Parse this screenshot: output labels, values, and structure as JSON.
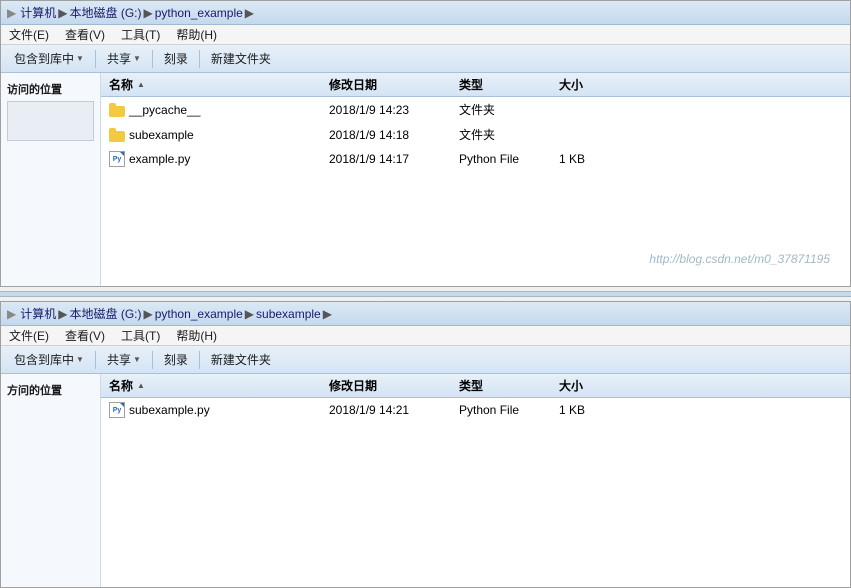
{
  "window1": {
    "address": {
      "parts": [
        "计算机",
        "本地磁盘 (G:)",
        "python_example"
      ]
    },
    "menu": {
      "items": [
        "文件(E)",
        "查看(V)",
        "工具(T)",
        "帮助(H)"
      ]
    },
    "toolbar": {
      "buttons": [
        "包含到库中",
        "共享",
        "刻录",
        "新建文件夹"
      ]
    },
    "sidebar": {
      "section1_title": "访问的位置"
    },
    "columns": {
      "name": "名称",
      "date": "修改日期",
      "type": "类型",
      "size": "大小"
    },
    "files": [
      {
        "name": "__pycache__",
        "date": "2018/1/9 14:23",
        "type": "文件夹",
        "size": "",
        "icon": "folder"
      },
      {
        "name": "subexample",
        "date": "2018/1/9 14:18",
        "type": "文件夹",
        "size": "",
        "icon": "folder"
      },
      {
        "name": "example.py",
        "date": "2018/1/9 14:17",
        "type": "Python File",
        "size": "1 KB",
        "icon": "python"
      }
    ],
    "watermark": "http://blog.csdn.net/m0_37871195"
  },
  "window2": {
    "address": {
      "parts": [
        "计算机",
        "本地磁盘 (G:)",
        "python_example",
        "subexample"
      ]
    },
    "menu": {
      "items": [
        "文件(E)",
        "查看(V)",
        "工具(T)",
        "帮助(H)"
      ]
    },
    "toolbar": {
      "buttons": [
        "包含到库中",
        "共享",
        "刻录",
        "新建文件夹"
      ]
    },
    "sidebar": {
      "section1_title": "方问的位置"
    },
    "columns": {
      "name": "名称",
      "date": "修改日期",
      "type": "类型",
      "size": "大小"
    },
    "files": [
      {
        "name": "subexample.py",
        "date": "2018/1/9 14:21",
        "type": "Python File",
        "size": "1 KB",
        "icon": "python"
      }
    ]
  }
}
